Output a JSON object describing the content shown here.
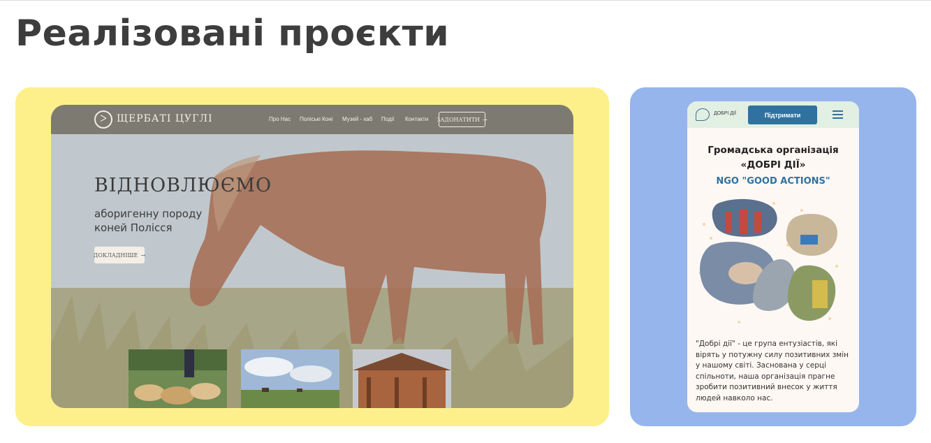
{
  "page": {
    "title": "Реалізовані проєкти"
  },
  "project1": {
    "logo_text": "ЩЕРБАТІ ЦУГЛІ",
    "nav": [
      "Про Нас",
      "Поліські Коні",
      "Музей - хаб",
      "Події",
      "Контакти"
    ],
    "nav_button": "ЗАДОНАТИТИ",
    "hero_title": "ВІДНОВЛЮЄМО",
    "hero_subtitle": "аборигенну породу коней Полісся",
    "hero_button": "ДОКЛАДНІШЕ",
    "accent": "#fdf08a"
  },
  "project2": {
    "logo_text": "ДОБРІ ДІЇ",
    "header_button": "Підтримати",
    "org_title": "Громадська організація «ДОБРІ ДІЇ»",
    "org_title_en": "NGO \"GOOD ACTIONS\"",
    "description": "\"Добрі дії\" - це група ентузіастів, які вірять у потужну силу позитивних змін у нашому світі. Заснована у серці спільноти, наша організація прагне зробити позитивний внесок у життя людей навколо нас.",
    "accent": "#96b5ec"
  }
}
